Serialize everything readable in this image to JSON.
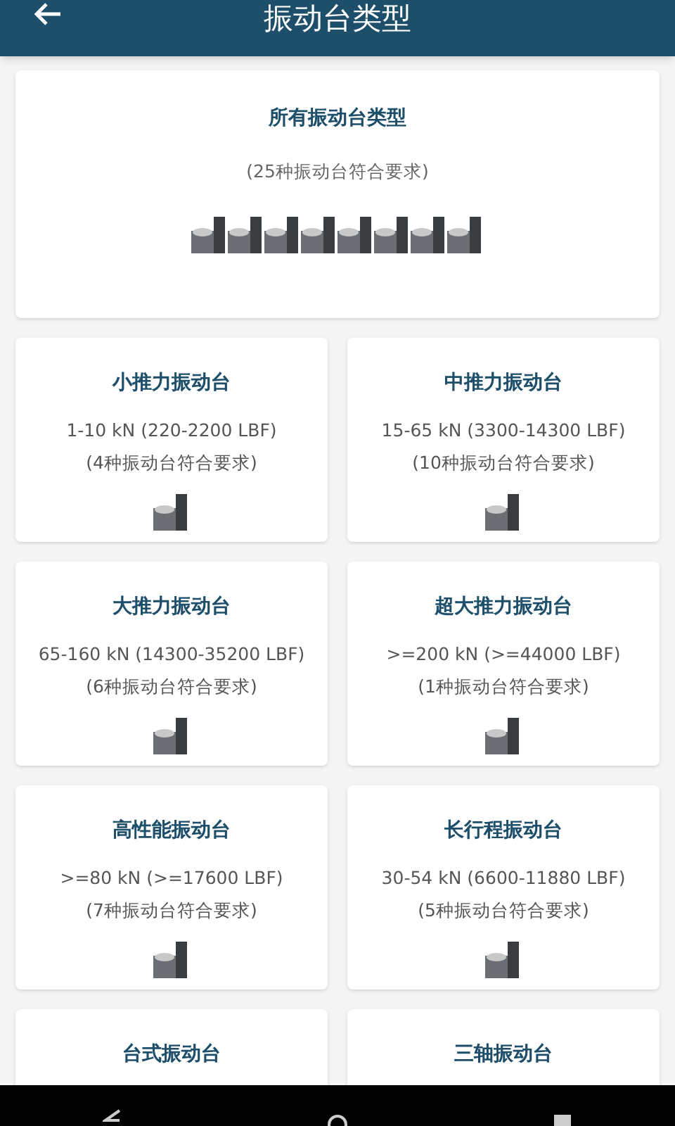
{
  "app_bar": {
    "title": "振动台类型"
  },
  "all_card": {
    "title": "所有振动台类型",
    "count": "(25种振动台符合要求)"
  },
  "categories": [
    {
      "title": "小推力振动台",
      "range": "1-10 kN (220-2200 LBF)",
      "count": "(4种振动台符合要求)"
    },
    {
      "title": "中推力振动台",
      "range": "15-65 kN (3300-14300 LBF)",
      "count": "(10种振动台符合要求)"
    },
    {
      "title": "大推力振动台",
      "range": "65-160 kN (14300-35200 LBF)",
      "count": "(6种振动台符合要求)"
    },
    {
      "title": "超大推力振动台",
      "range": ">=200 kN (>=44000 LBF)",
      "count": "(1种振动台符合要求)"
    },
    {
      "title": "高性能振动台",
      "range": ">=80 kN (>=17600 LBF)",
      "count": "(7种振动台符合要求)"
    },
    {
      "title": "长行程振动台",
      "range": "30-54 kN (6600-11880 LBF)",
      "count": "(5种振动台符合要求)"
    },
    {
      "title": "台式振动台"
    },
    {
      "title": "三轴振动台"
    }
  ]
}
